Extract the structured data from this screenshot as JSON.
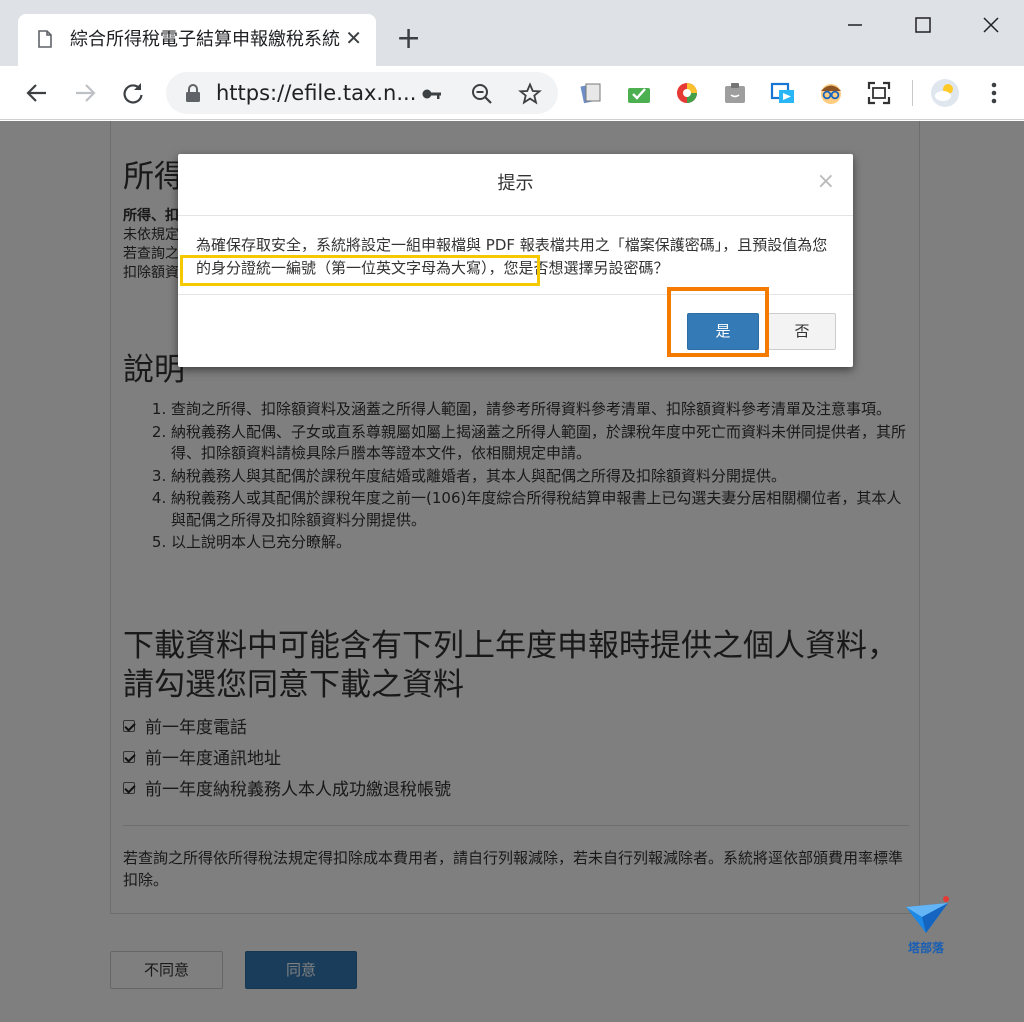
{
  "browser": {
    "tab_title": "綜合所得稅電子結算申報繳稅系統",
    "tab_close": "✕",
    "new_tab": "+",
    "url": "https://efile.tax.n..."
  },
  "page": {
    "heading": "所得、扣除額資料查詢",
    "intro": [
      "所得、扣",
      "未依規定",
      "若查詢之",
      "扣除額資"
    ],
    "explain_heading": "說明",
    "explain_items": [
      "查詢之所得、扣除額資料及涵蓋之所得人範圍，請參考所得資料參考清單、扣除額資料參考清單及注意事項。",
      "納稅義務人配偶、子女或直系尊親屬如屬上揭涵蓋之所得人範圍，於課稅年度中死亡而資料未併同提供者，其所得、扣除額資料請檢具除戶謄本等證本文件，依相關規定申請。",
      "納稅義務人與其配偶於課稅年度結婚或離婚者，其本人與配偶之所得及扣除額資料分開提供。",
      "納稅義務人或其配偶於課稅年度之前一(106)年度綜合所得稅結算申報書上已勾選夫妻分居相關欄位者，其本人 與配偶之所得及扣除額資料分開提供。",
      "以上說明本人已充分瞭解。"
    ],
    "download_heading": "下載資料中可能含有下列上年度申報時提供之個人資料，請勾選您同意下載之資料",
    "checkboxes": [
      {
        "label": "前一年度電話",
        "checked": true
      },
      {
        "label": "前一年度通訊地址",
        "checked": true
      },
      {
        "label": "前一年度納稅義務人本人成功繳退稅帳號",
        "checked": true
      }
    ],
    "footnote": "若查詢之所得依所得稅法規定得扣除成本費用者，請自行列報減除，若未自行列報減除者。系統將逕依部頒費用率標準扣除。",
    "disagree_label": "不同意",
    "agree_label": "同意"
  },
  "modal": {
    "title": "提示",
    "close": "×",
    "body": "為確保存取安全，系統將設定一組申報檔與 PDF 報表檔共用之「檔案保護密碼」，且預設值為您的身分證統一編號（第一位英文字母為大寫），您是否想選擇另設密碼？",
    "yes_label": "是",
    "no_label": "否"
  },
  "watermark": {
    "text": "塔部落"
  },
  "colors": {
    "primary_button": "#337ab7",
    "highlight_yellow": "#f5c800",
    "highlight_orange": "#f47a00"
  }
}
